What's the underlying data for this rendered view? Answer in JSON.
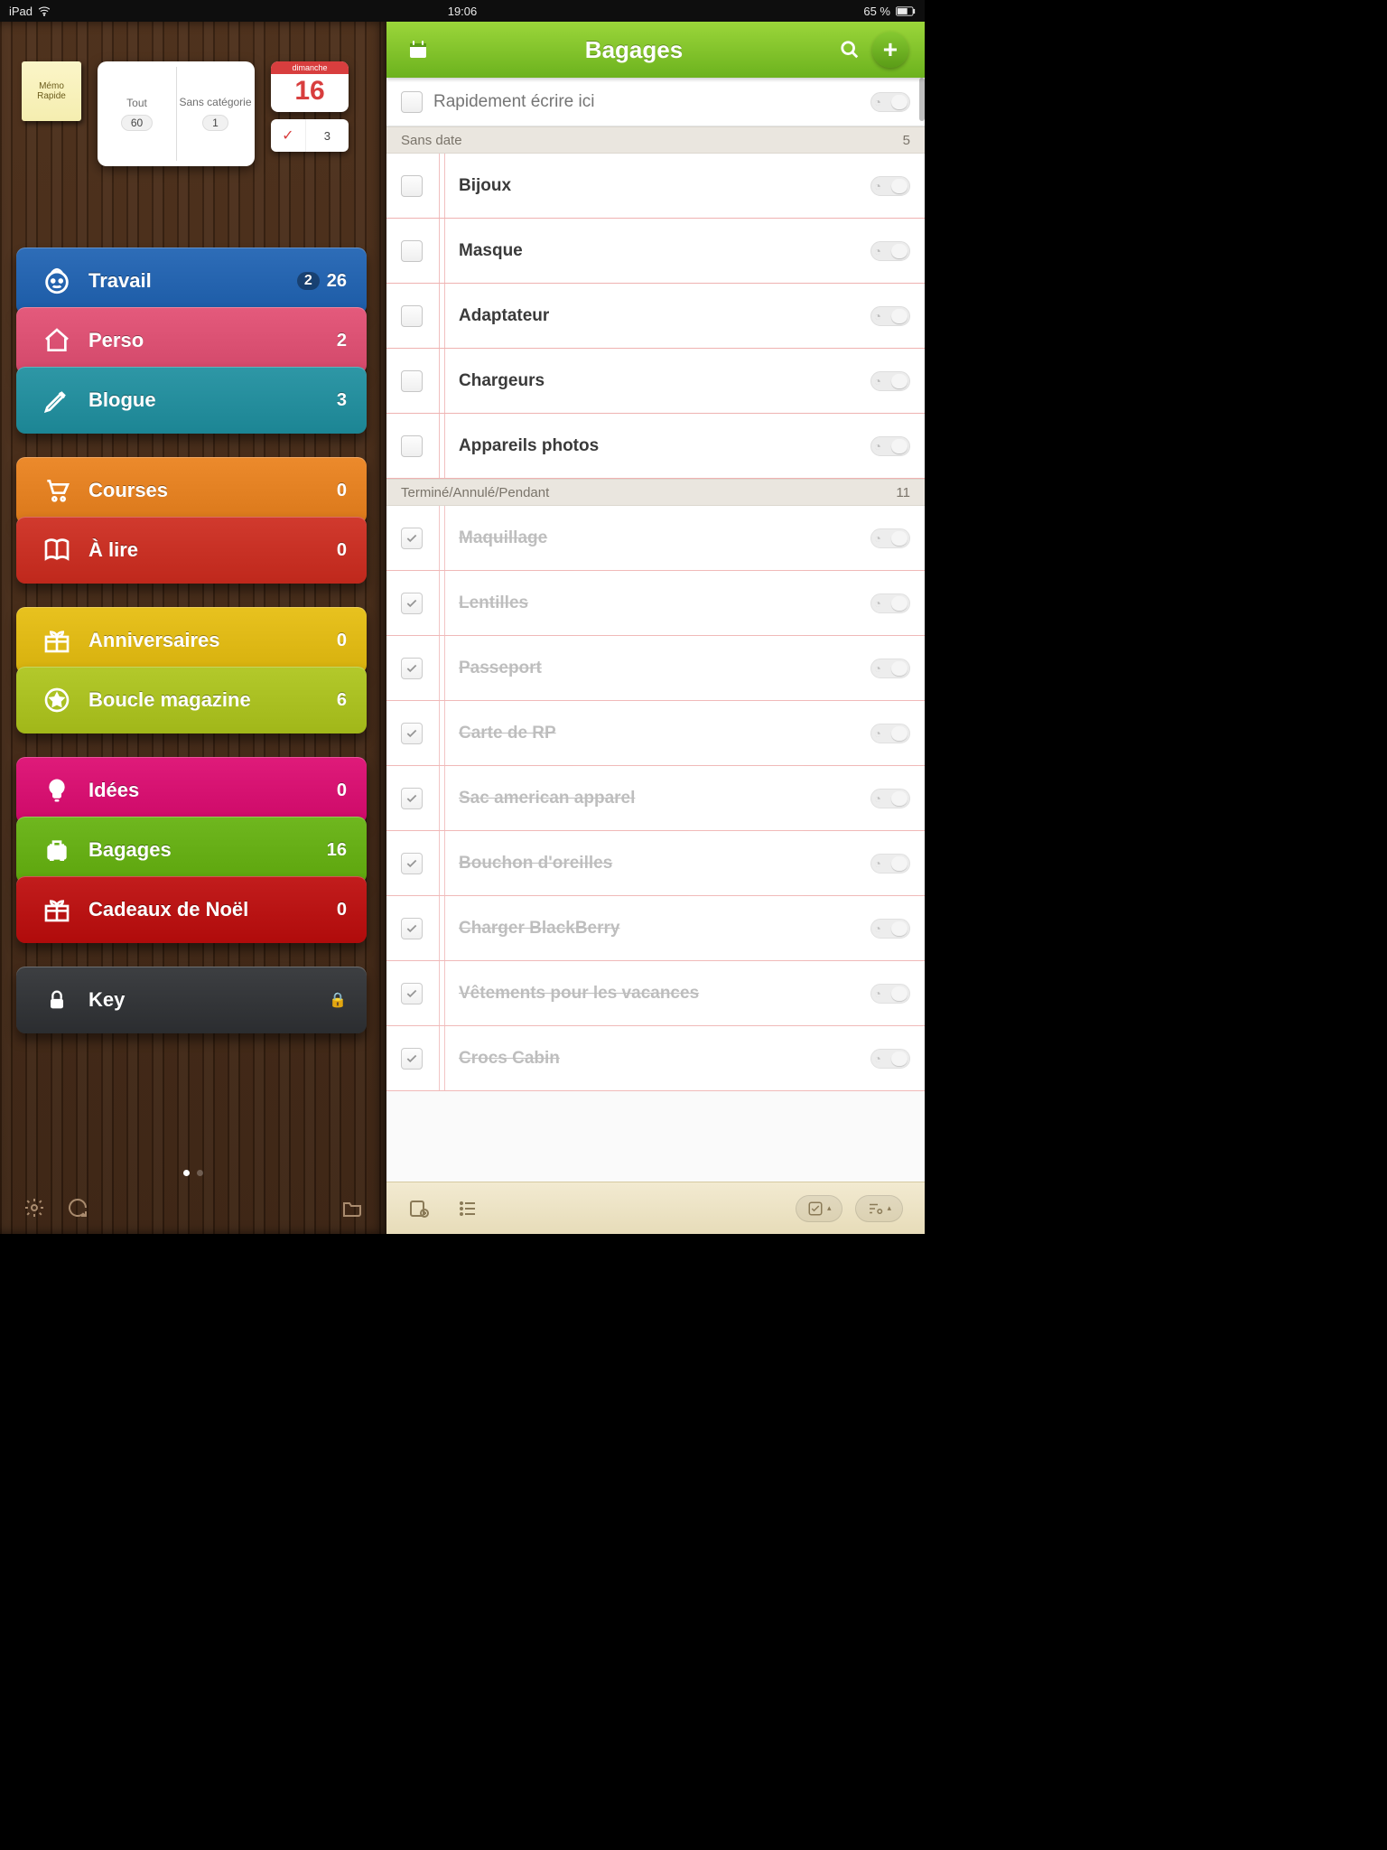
{
  "status": {
    "device": "iPad",
    "time": "19:06",
    "battery": "65 %"
  },
  "sidebar": {
    "sticky": "Mémo\nRapide",
    "book": {
      "left_label": "Tout",
      "left_count": "60",
      "right_label": "Sans catégorie",
      "right_count": "1"
    },
    "calendar": {
      "weekday": "dimanche",
      "day": "16",
      "done_count": "3"
    },
    "groups": [
      {
        "items": [
          {
            "id": "travail",
            "label": "Travail",
            "count": "26",
            "badge": "2",
            "color": "#2e6db8",
            "icon": "face-icon"
          },
          {
            "id": "perso",
            "label": "Perso",
            "count": "2",
            "color": "#e45a7c",
            "icon": "home-icon"
          },
          {
            "id": "blogue",
            "label": "Blogue",
            "count": "3",
            "color": "#2e97a6",
            "icon": "pencil-icon"
          }
        ]
      },
      {
        "items": [
          {
            "id": "courses",
            "label": "Courses",
            "count": "0",
            "color": "#ec8a2c",
            "icon": "cart-icon"
          },
          {
            "id": "alire",
            "label": "À lire",
            "count": "0",
            "color": "#d13a2e",
            "icon": "book-icon"
          }
        ]
      },
      {
        "items": [
          {
            "id": "anniv",
            "label": "Anniversaires",
            "count": "0",
            "color": "#e8c21f",
            "icon": "gift-icon"
          },
          {
            "id": "boucle",
            "label": "Boucle magazine",
            "count": "6",
            "color": "#b3c92b",
            "icon": "star-icon"
          }
        ]
      },
      {
        "items": [
          {
            "id": "idees",
            "label": "Idées",
            "count": "0",
            "color": "#df1b7a",
            "icon": "bulb-icon"
          },
          {
            "id": "bagages",
            "label": "Bagages",
            "count": "16",
            "color": "#6fb71f",
            "icon": "suitcase-icon",
            "selected": true
          },
          {
            "id": "noel",
            "label": "Cadeaux de Noël",
            "count": "0",
            "color": "#c21d1d",
            "icon": "gift-icon"
          }
        ]
      },
      {
        "items": [
          {
            "id": "key",
            "label": "Key",
            "count": "",
            "color": "#3d3f42",
            "icon": "lock-icon",
            "locked": true
          }
        ]
      }
    ]
  },
  "detail": {
    "title": "Bagages",
    "quick_placeholder": "Rapidement écrire ici",
    "sections": [
      {
        "title": "Sans date",
        "count": "5",
        "tasks": [
          {
            "text": "Bijoux",
            "done": false
          },
          {
            "text": "Masque",
            "done": false
          },
          {
            "text": "Adaptateur",
            "done": false
          },
          {
            "text": "Chargeurs",
            "done": false
          },
          {
            "text": "Appareils photos",
            "done": false
          }
        ]
      },
      {
        "title": "Terminé/Annulé/Pendant",
        "count": "11",
        "tasks": [
          {
            "text": "Maquillage",
            "done": true
          },
          {
            "text": "Lentilles",
            "done": true
          },
          {
            "text": "Passeport",
            "done": true
          },
          {
            "text": "Carte de RP",
            "done": true
          },
          {
            "text": "Sac american apparel",
            "done": true
          },
          {
            "text": "Bouchon d'oreilles",
            "done": true
          },
          {
            "text": "Charger BlackBerry",
            "done": true
          },
          {
            "text": "Vêtements pour les vacances",
            "done": true
          },
          {
            "text": "Crocs Cabin",
            "done": true
          }
        ]
      }
    ]
  }
}
